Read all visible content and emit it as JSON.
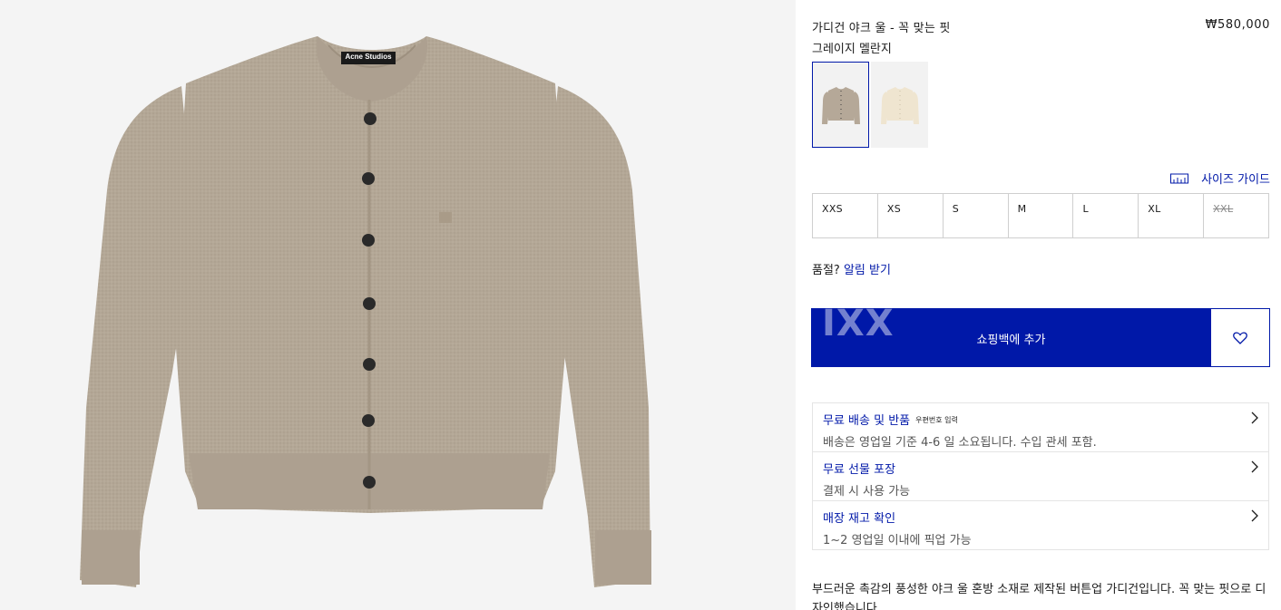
{
  "product": {
    "title": "가디건 야크 울 - 꼭 맞는 핏",
    "price": "₩580,000",
    "color": "그레이지 멜란지",
    "image_label": "Acne Studios",
    "swatches": [
      {
        "name": "greige-swatch",
        "color": "#b5a898",
        "selected": true
      },
      {
        "name": "cream-swatch",
        "color": "#efe5d0",
        "selected": false
      }
    ],
    "description": "부드러운 촉감의 풍성한 야크 울 혼방 소재로 제작된 버튼업 가디건입니다. 꼭 맞는 핏으로 디자인했습니다."
  },
  "size_guide_label": "사이즈 가이드",
  "sizes": [
    {
      "label": "XXS",
      "available": true
    },
    {
      "label": "XS",
      "available": true
    },
    {
      "label": "S",
      "available": true
    },
    {
      "label": "M",
      "available": true
    },
    {
      "label": "L",
      "available": true
    },
    {
      "label": "XL",
      "available": true
    },
    {
      "label": "XXL",
      "available": false
    }
  ],
  "soldout": {
    "prefix": "품절?",
    "link": "알림 받기"
  },
  "cart": {
    "label": "쇼핑백에 추가",
    "ghost_text": "IXX"
  },
  "info": [
    {
      "title": "무료 배송 및 반품",
      "extra": "우편번호 입력",
      "sub": "배송은 영업일 기준 4-6 일 소요됩니다. 수입 관세 포함."
    },
    {
      "title": "무료 선물 포장",
      "extra": "",
      "sub": "결제 시 사용 가능"
    },
    {
      "title": "매장 재고 확인",
      "extra": "",
      "sub": "1~2 영업일 이내에 픽업 가능"
    }
  ],
  "colors": {
    "accent": "#0018a8",
    "knit": "#b3a796"
  }
}
